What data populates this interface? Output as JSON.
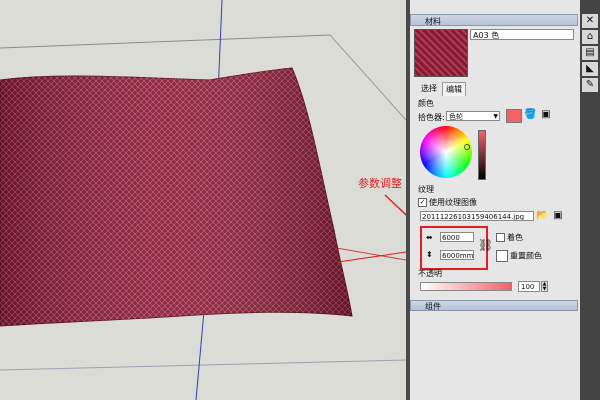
{
  "callout": {
    "text": "参数调整"
  },
  "materials_panel": {
    "title": "材料",
    "material_name": "A03 色",
    "tabs": [
      {
        "label": "选择"
      },
      {
        "label": "编辑"
      }
    ],
    "color_section": {
      "label": "颜色",
      "picker_label": "拾色器:",
      "picker_value": "色轮",
      "current_color": "#f06468"
    },
    "texture_section": {
      "label": "纹理",
      "use_texture_label": "使用纹理图像",
      "file_name": "20111226103159406144.jpg",
      "width_value": "6000",
      "height_value": "6000mm",
      "colorize_label": "着色",
      "reset_color_label": "重置颜色"
    },
    "opacity_section": {
      "label": "不透明",
      "value": "100"
    },
    "components_title": "组件"
  },
  "colors": {
    "pillow": "#8a1830",
    "accent_red": "#e02020"
  }
}
